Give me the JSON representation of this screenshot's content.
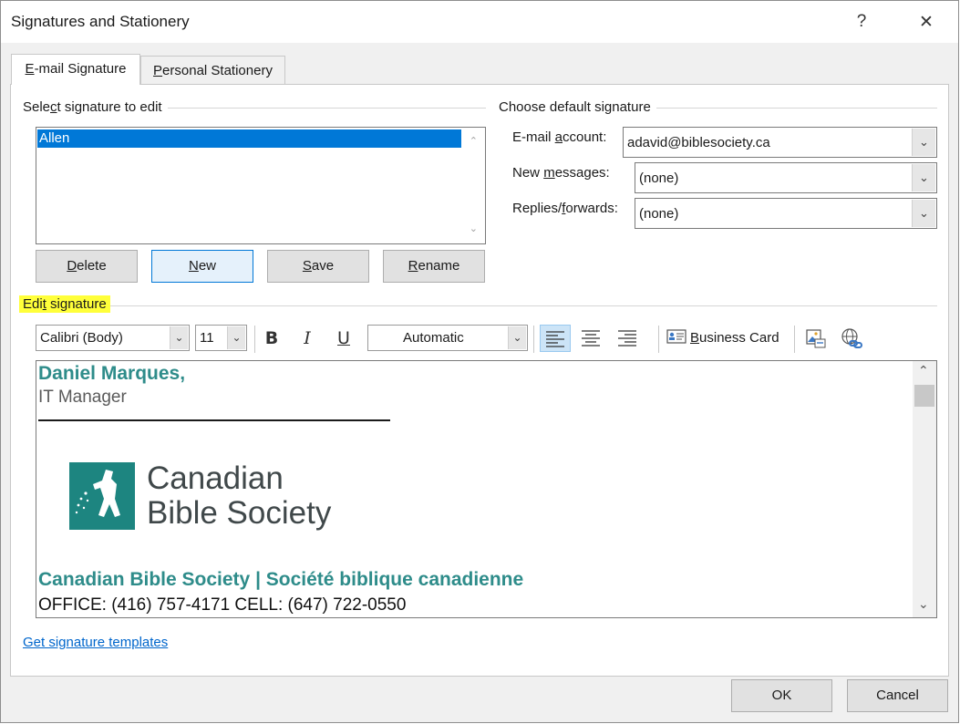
{
  "window": {
    "title": "Signatures and Stationery",
    "help_label": "?",
    "close_label": "✕"
  },
  "tabs": [
    {
      "label_pre": "",
      "label_u": "E",
      "label_post": "-mail Signature"
    },
    {
      "label_pre": "",
      "label_u": "P",
      "label_post": "ersonal Stationery"
    }
  ],
  "select_section": {
    "label_pre": "Sele",
    "label_u": "c",
    "label_post": "t signature to edit",
    "items": [
      "Allen"
    ]
  },
  "buttons": {
    "delete": {
      "u": "D",
      "rest": "elete"
    },
    "new": {
      "u": "N",
      "rest": "ew"
    },
    "save": {
      "u": "S",
      "rest": "ave"
    },
    "rename": {
      "u": "R",
      "rest": "ename"
    }
  },
  "default_section": {
    "label": "Choose default signature",
    "email_label_pre": "E-mail ",
    "email_label_u": "a",
    "email_label_post": "ccount:",
    "email_value": "adavid@biblesociety.ca",
    "new_label_pre": "New ",
    "new_label_u": "m",
    "new_label_post": "essages:",
    "new_value": "(none)",
    "replies_label_pre": "Replies/",
    "replies_label_u": "f",
    "replies_label_post": "orwards:",
    "replies_value": "(none)"
  },
  "edit_section": {
    "label_pre": "Edi",
    "label_u": "t",
    "label_post": " signature"
  },
  "toolbar": {
    "font": "Calibri (Body)",
    "size": "11",
    "bold": "B",
    "italic": "I",
    "underline": "U",
    "color": "Automatic",
    "business_card_u": "B",
    "business_card_rest": "usiness Card"
  },
  "signature": {
    "name": "Daniel Marques,",
    "role": "IT Manager",
    "logo_line1": "Canadian",
    "logo_line2": "Bible Society",
    "org": "Canadian Bible Society | Société biblique canadienne",
    "phones": "OFFICE: (416) 757-4171 CELL: (647) 722-0550"
  },
  "templates_link": "Get signature templates",
  "footer": {
    "ok": "OK",
    "cancel": "Cancel"
  },
  "colors": {
    "accent": "#0078d7",
    "signature_teal": "#2e8c8a",
    "logo_teal": "#1d8580",
    "logo_text": "#40484a",
    "highlight": "#ffff3a"
  }
}
